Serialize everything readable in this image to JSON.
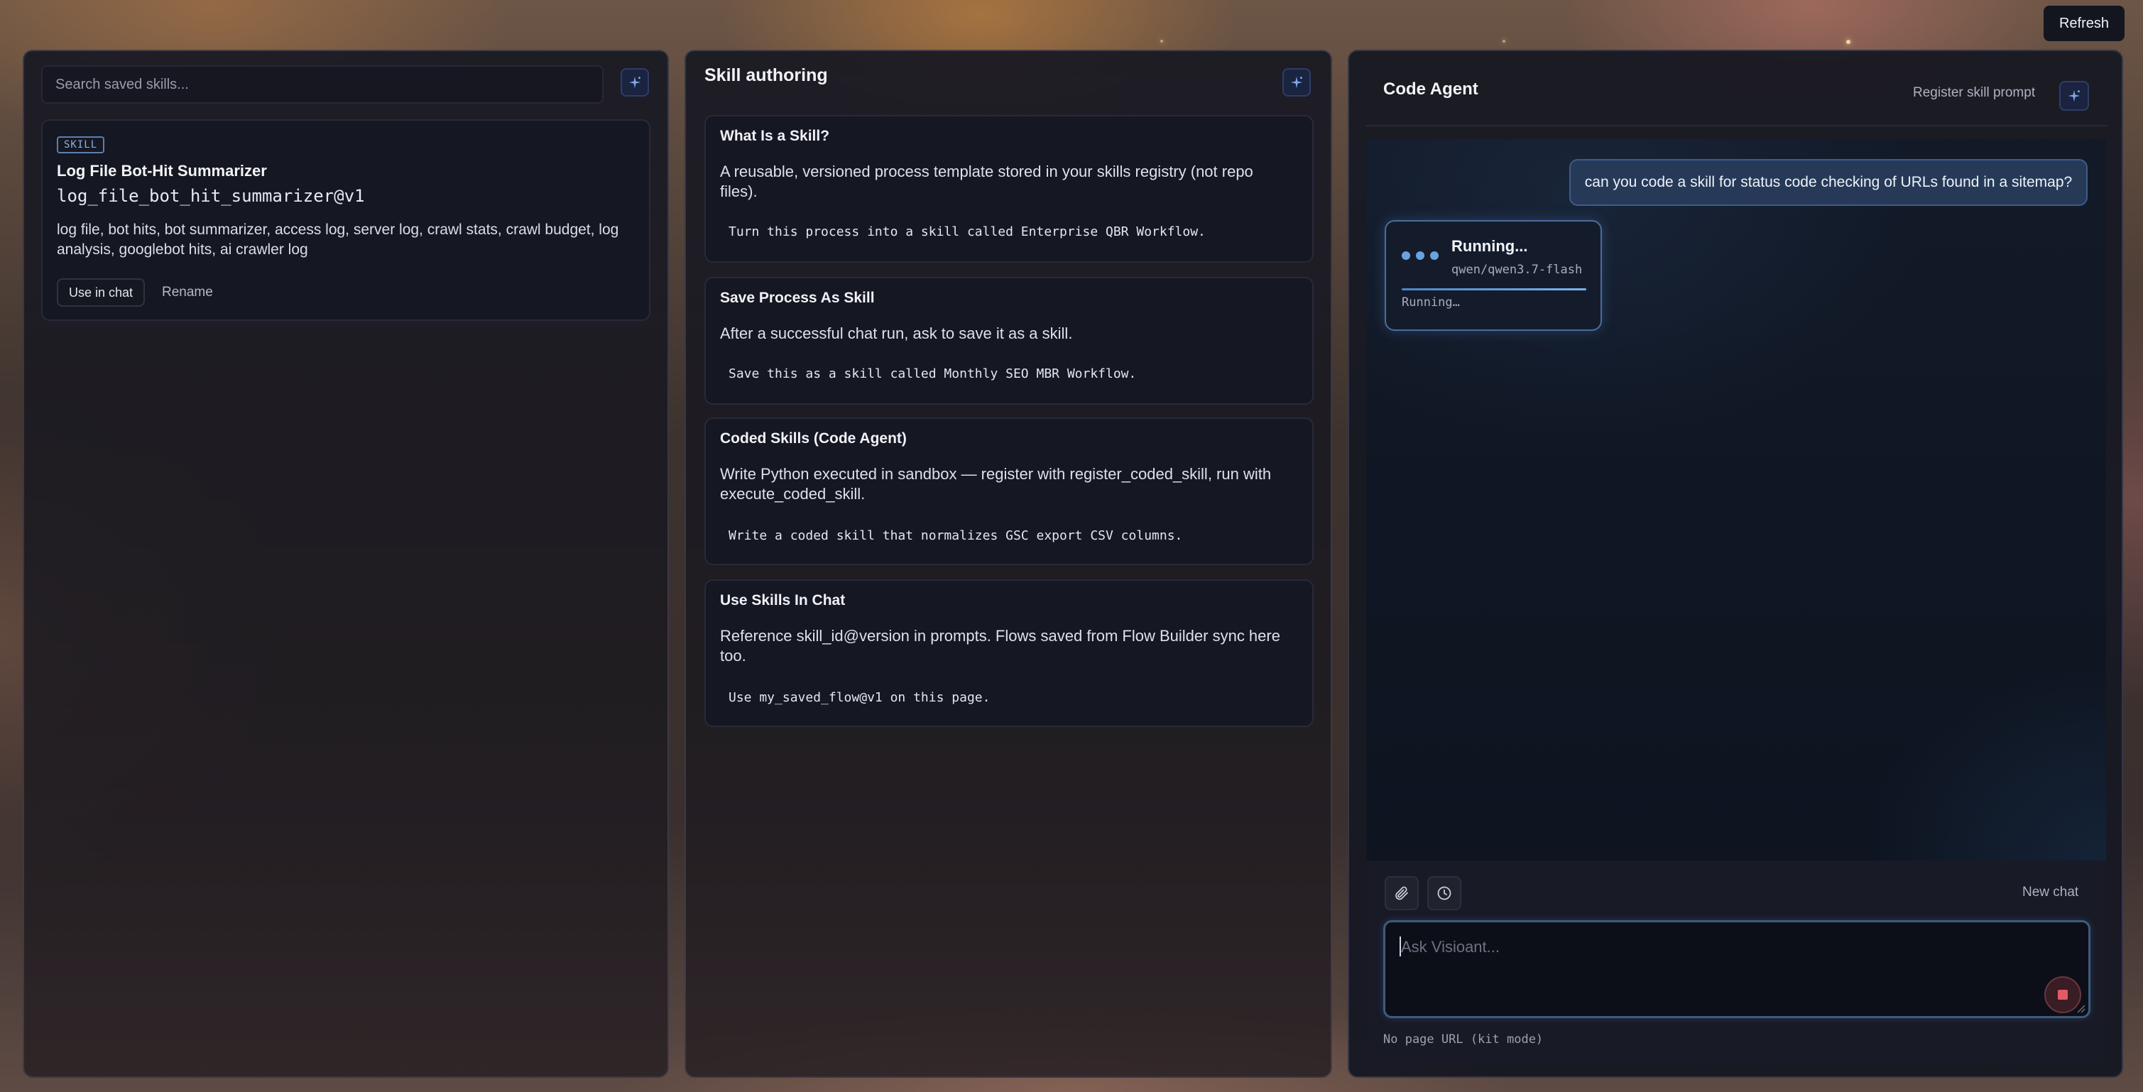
{
  "toolbar": {
    "refresh_label": "Refresh"
  },
  "library": {
    "search_placeholder": "Search saved skills...",
    "skill": {
      "tag": "SKILL",
      "title": "Log File Bot-Hit Summarizer",
      "id": "log_file_bot_hit_summarizer@v1",
      "keywords": "log file, bot hits, bot summarizer, access log, server log, crawl stats, crawl budget, log analysis, googlebot hits, ai crawler log",
      "use_label": "Use in chat",
      "rename_label": "Rename"
    }
  },
  "authoring": {
    "title": "Skill authoring",
    "cards": [
      {
        "title": "What Is a Skill?",
        "description": "A reusable, versioned process template stored in your skills registry (not repo files).",
        "example": "Turn this process into a skill called Enterprise QBR Workflow."
      },
      {
        "title": "Save Process As Skill",
        "description": "After a successful chat run, ask to save it as a skill.",
        "example": "Save this as a skill called Monthly SEO MBR Workflow."
      },
      {
        "title": "Coded Skills (Code Agent)",
        "description": "Write Python executed in sandbox — register with register_coded_skill, run with execute_coded_skill.",
        "example": "Write a coded skill that normalizes GSC export CSV columns."
      },
      {
        "title": "Use Skills In Chat",
        "description": "Reference skill_id@version in prompts. Flows saved from Flow Builder sync here too.",
        "example": "Use my_saved_flow@v1 on this page."
      }
    ]
  },
  "agent": {
    "title": "Code Agent",
    "register_label": "Register skill prompt",
    "user_message": "can you code a skill for status code checking of URLs found in a sitemap?",
    "running": {
      "title": "Running...",
      "model": "qwen/qwen3.7-flash",
      "status": "Running…"
    },
    "new_chat_label": "New chat",
    "input_placeholder": "Ask Visioant...",
    "page_url_note": "No page URL (kit mode)"
  },
  "colors": {
    "accent": "#6aa2de",
    "user_bubble": "#263a58",
    "stop": "#e25b64"
  }
}
